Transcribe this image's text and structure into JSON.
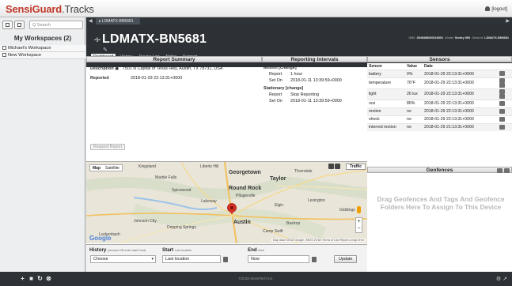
{
  "app": {
    "brand_1": "SensiGuard",
    "brand_2": ".Tracks",
    "logout": "[logout]"
  },
  "sidebar": {
    "search_placeholder": "Q Search",
    "title": "My Workspaces (2)",
    "items": [
      {
        "label": "Michael's Workspace"
      },
      {
        "label": "New Workspace"
      }
    ]
  },
  "device": {
    "tab_label": "LDMATX-BN5681",
    "title": "LDMATX-BN5681",
    "meta": {
      "imei_label": "IMEI:",
      "imei": "3545458000016051",
      "model_label": "Model:",
      "model": "Sentry 500",
      "serial_label": "Serial Id:",
      "serial": "LDMATX-BN5681"
    },
    "nav_tabs": [
      "Dashboard",
      "History",
      "Device Log",
      "Notes",
      "Support"
    ]
  },
  "report_summary": {
    "title": "Report Summary",
    "description_label": "Description",
    "description": "7501 N Capital of Texas Hwy, Austin, TX 78731, USA",
    "reported_label": "Reported",
    "reported": "2018-01-29 22:13:31+0000",
    "request_button": "Request Report"
  },
  "reporting_intervals": {
    "title": "Reporting Intervals",
    "motion_header": "Motion [change]",
    "motion_report_label": "Report",
    "motion_report": "1 hour",
    "motion_set_label": "Set On",
    "motion_set": "2018-01-11 13:39:59+0000",
    "stationary_header": "Stationary [change]",
    "stationary_report_label": "Report",
    "stationary_report": "Stop Reporting",
    "stationary_set_label": "Set On",
    "stationary_set": "2018-01-11 13:39:59+0000"
  },
  "sensors": {
    "title": "Sensors",
    "headers": [
      "Sensor",
      "Value",
      "Date"
    ],
    "rows": [
      {
        "sensor": "battery",
        "value": "0%",
        "date": "2018-01-29 22:13:31+0000"
      },
      {
        "sensor": "temperature",
        "value": "76°F",
        "date": "2018-01-29 22:13:31+0000"
      },
      {
        "sensor": "light",
        "value": "26 lux",
        "date": "2018-01-29 22:13:31+0000"
      },
      {
        "sensor": "rssi",
        "value": "86%",
        "date": "2018-01-29 22:13:31+0000"
      },
      {
        "sensor": "motion",
        "value": "no",
        "date": "2018-01-29 22:13:31+0000"
      },
      {
        "sensor": "shock",
        "value": "no",
        "date": "2018-01-29 22:13:31+0000"
      },
      {
        "sensor": "interred motion",
        "value": "no",
        "date": "2018-01-29 21:13:31+0000"
      }
    ]
  },
  "map": {
    "map_label": "Map",
    "satellite_label": "Satellite",
    "traffic_label": "Traffic",
    "places": {
      "kingsland": "Kingsland",
      "liberty_hill": "Liberty Hill",
      "georgetown": "Georgetown",
      "marble_falls": "Marble Falls",
      "taylor": "Taylor",
      "thorndale": "Thorndale",
      "spicewood": "Spicewood",
      "round_rock": "Round Rock",
      "pflugerville": "Pflugerville",
      "lakeway": "Lakeway",
      "johnson_city": "Johnson City",
      "austin": "Austin",
      "giddings": "Giddings",
      "lexington": "Lexington",
      "bastrop": "Bastrop",
      "elgin": "Elgin",
      "dripping_springs": "Dripping Springs",
      "lockhart": "Luckenbach",
      "camp_swift": "Camp Swift"
    },
    "zoom_in": "+",
    "zoom_out": "−",
    "footer": "Map data ©2018 Google, INEGI   20 km   Terms of Use   Report a map error"
  },
  "history": {
    "title": "History",
    "title_hint": "(choose OR enter start+end)",
    "choose_value": "Choose",
    "start_label": "Start",
    "start_hint": "Last location",
    "start_value": "Last location",
    "end_label": "End",
    "end_hint": "Now",
    "end_value": "Now",
    "update_button": "Update"
  },
  "geofences": {
    "title": "Geofences",
    "empty_text": "Drag Geofences And Tags And Geofence Folders Here To Assign To This Device"
  },
  "footer": {
    "copyright": "©2018 SensiTech Inc."
  }
}
